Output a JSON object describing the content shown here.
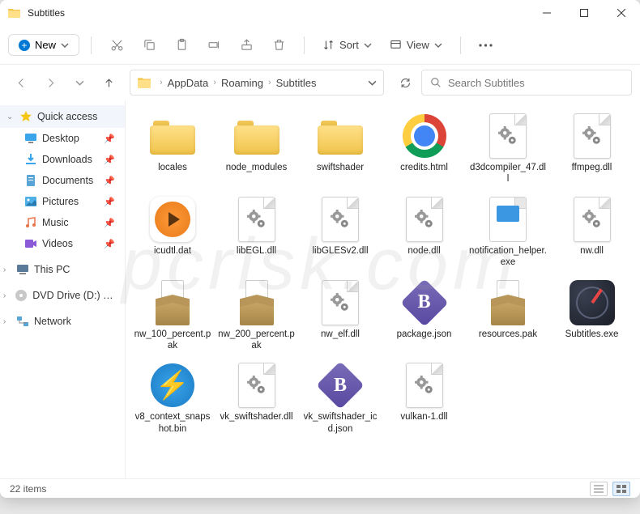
{
  "window": {
    "title": "Subtitles"
  },
  "toolbar": {
    "new_label": "New",
    "sort_label": "Sort",
    "view_label": "View"
  },
  "breadcrumb": {
    "parts": [
      "AppData",
      "Roaming",
      "Subtitles"
    ]
  },
  "search": {
    "placeholder": "Search Subtitles"
  },
  "sidebar": {
    "quick_access": "Quick access",
    "items": [
      {
        "label": "Desktop"
      },
      {
        "label": "Downloads"
      },
      {
        "label": "Documents"
      },
      {
        "label": "Pictures"
      },
      {
        "label": "Music"
      },
      {
        "label": "Videos"
      }
    ],
    "this_pc": "This PC",
    "dvd": "DVD Drive (D:) CCCC",
    "network": "Network"
  },
  "files": [
    {
      "name": "locales",
      "type": "folder"
    },
    {
      "name": "node_modules",
      "type": "folder"
    },
    {
      "name": "swiftshader",
      "type": "folder"
    },
    {
      "name": "credits.html",
      "type": "chrome"
    },
    {
      "name": "d3dcompiler_47.dll",
      "type": "dll"
    },
    {
      "name": "ffmpeg.dll",
      "type": "dll"
    },
    {
      "name": "icudtl.dat",
      "type": "play"
    },
    {
      "name": "libEGL.dll",
      "type": "dll"
    },
    {
      "name": "libGLESv2.dll",
      "type": "dll"
    },
    {
      "name": "node.dll",
      "type": "dll"
    },
    {
      "name": "notification_helper.exe",
      "type": "exe"
    },
    {
      "name": "nw.dll",
      "type": "dll"
    },
    {
      "name": "nw_100_percent.pak",
      "type": "pak"
    },
    {
      "name": "nw_200_percent.pak",
      "type": "pak"
    },
    {
      "name": "nw_elf.dll",
      "type": "dll"
    },
    {
      "name": "package.json",
      "type": "jsonb"
    },
    {
      "name": "resources.pak",
      "type": "pak"
    },
    {
      "name": "Subtitles.exe",
      "type": "compass"
    },
    {
      "name": "v8_context_snapshot.bin",
      "type": "bolt"
    },
    {
      "name": "vk_swiftshader.dll",
      "type": "dll"
    },
    {
      "name": "vk_swiftshader_icd.json",
      "type": "jsonb"
    },
    {
      "name": "vulkan-1.dll",
      "type": "dll"
    }
  ],
  "status": {
    "count": "22 items"
  },
  "watermark": "pcrisk.com"
}
